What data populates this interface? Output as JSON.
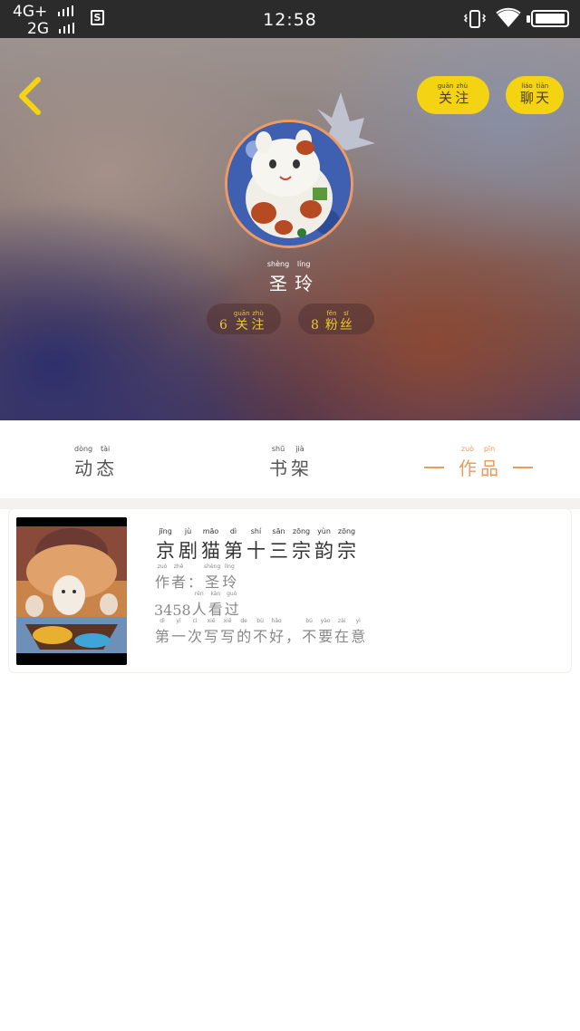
{
  "status_bar": {
    "network_1": "4G+",
    "network_2": "2G",
    "sim_label": "S",
    "time": "12:58"
  },
  "header": {
    "follow_button": [
      {
        "py": "guān",
        "hz": "关"
      },
      {
        "py": "zhù",
        "hz": "注"
      }
    ],
    "chat_button": [
      {
        "py": "liáo",
        "hz": "聊"
      },
      {
        "py": "tiān",
        "hz": "天"
      }
    ],
    "username": [
      {
        "py": "shèng",
        "hz": "圣"
      },
      {
        "py": "líng",
        "hz": "玲"
      }
    ],
    "following_count": "6",
    "following_label": [
      {
        "py": "guān",
        "hz": "关"
      },
      {
        "py": "zhù",
        "hz": "注"
      }
    ],
    "followers_count": "8",
    "followers_label": [
      {
        "py": "fěn",
        "hz": "粉"
      },
      {
        "py": "sī",
        "hz": "丝"
      }
    ]
  },
  "tabs": {
    "dynamic": [
      {
        "py": "dòng",
        "hz": "动"
      },
      {
        "py": "tài",
        "hz": "态"
      }
    ],
    "shelf": [
      {
        "py": "shū",
        "hz": "书"
      },
      {
        "py": "jià",
        "hz": "架"
      }
    ],
    "works": [
      {
        "py": "zuò",
        "hz": "作"
      },
      {
        "py": "pǐn",
        "hz": "品"
      }
    ]
  },
  "work": {
    "title": [
      {
        "py": "jīng",
        "hz": "京"
      },
      {
        "py": "jù",
        "hz": "剧"
      },
      {
        "py": "māo",
        "hz": "猫"
      },
      {
        "py": "dì",
        "hz": "第"
      },
      {
        "py": "shí",
        "hz": "十"
      },
      {
        "py": "sān",
        "hz": "三"
      },
      {
        "py": "zōng",
        "hz": "宗"
      },
      {
        "py": "yùn",
        "hz": "韵"
      },
      {
        "py": "zōng",
        "hz": "宗"
      }
    ],
    "author_label": [
      {
        "py": "zuò",
        "hz": "作"
      },
      {
        "py": "zhě",
        "hz": "者"
      },
      {
        "py": "",
        "hz": "："
      }
    ],
    "author_name": [
      {
        "py": "shèng",
        "hz": "圣"
      },
      {
        "py": "líng",
        "hz": "玲"
      }
    ],
    "views_number": "3458",
    "views_label": [
      {
        "py": "rén",
        "hz": "人"
      },
      {
        "py": "kàn",
        "hz": "看"
      },
      {
        "py": "guò",
        "hz": "过"
      }
    ],
    "description": [
      {
        "py": "dì",
        "hz": "第"
      },
      {
        "py": "yī",
        "hz": "一"
      },
      {
        "py": "cì",
        "hz": "次"
      },
      {
        "py": "xiě",
        "hz": "写"
      },
      {
        "py": "xiě",
        "hz": "写"
      },
      {
        "py": "de",
        "hz": "的"
      },
      {
        "py": "bù",
        "hz": "不"
      },
      {
        "py": "hǎo",
        "hz": "好"
      },
      {
        "py": "",
        "hz": "，"
      },
      {
        "py": "bú",
        "hz": "不"
      },
      {
        "py": "yào",
        "hz": "要"
      },
      {
        "py": "zài",
        "hz": "在"
      },
      {
        "py": "yì",
        "hz": "意"
      }
    ]
  },
  "colors": {
    "accent_yellow": "#f4d313",
    "accent_orange": "#f09a58",
    "count_text": "#e8c63a"
  }
}
